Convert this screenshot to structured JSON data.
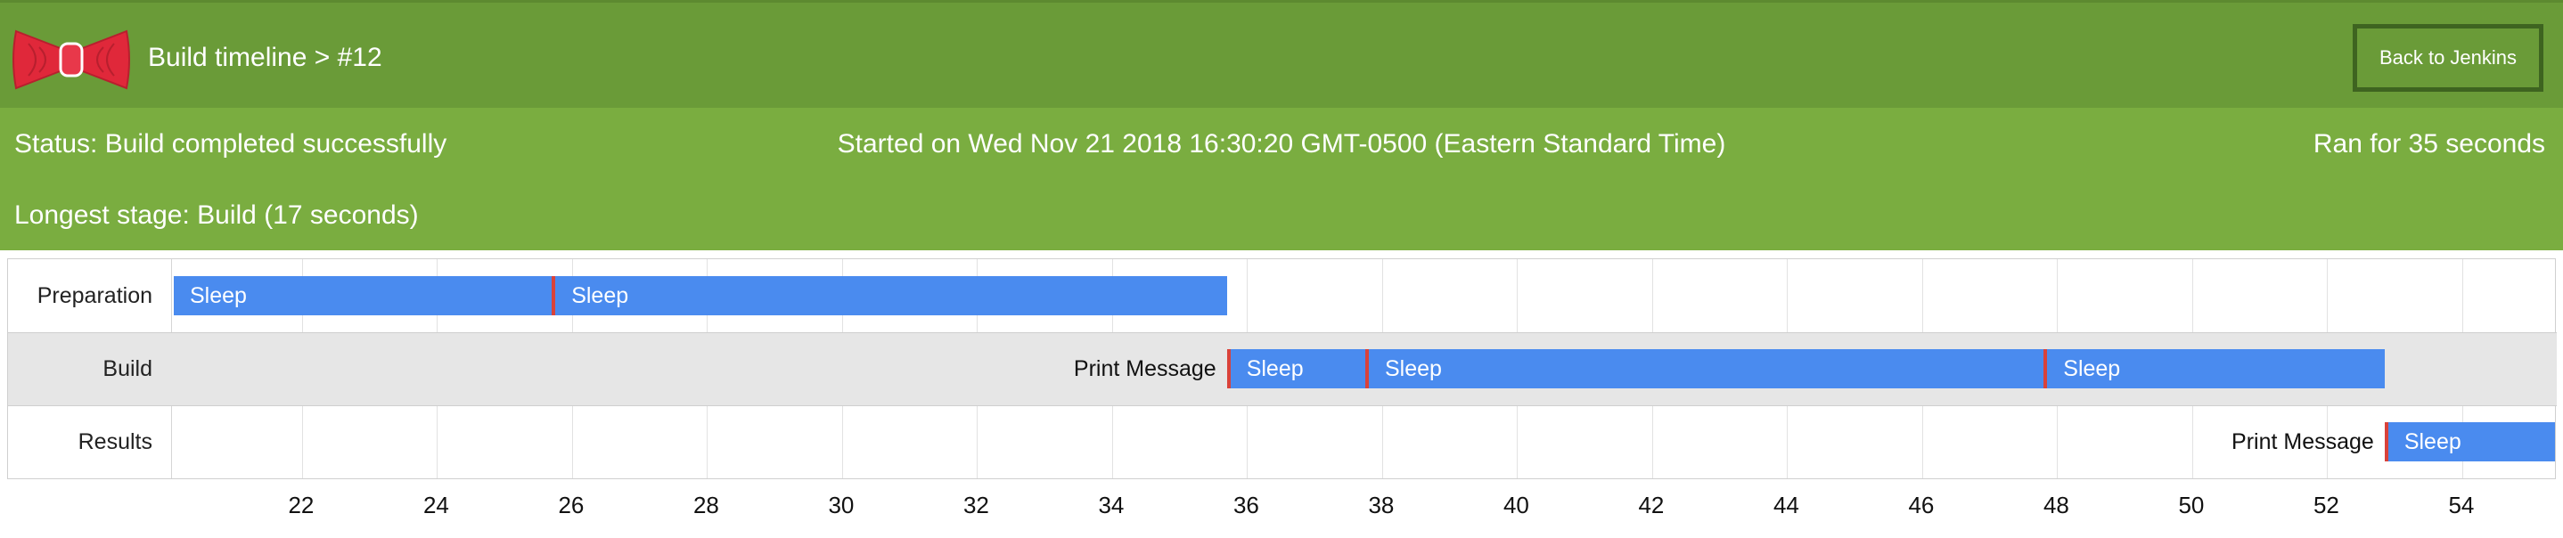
{
  "header": {
    "title": "Build timeline > #12",
    "back_button": "Back to Jenkins",
    "logo_icon": "red-bowtie-logo",
    "colors": {
      "header": "#6a9b38",
      "status": "#7aad40",
      "bar": "#4a8bef",
      "marker": "#d9423a"
    }
  },
  "status": {
    "status": "Status: Build completed successfully",
    "started": "Started on Wed Nov 21 2018 16:30:20 GMT-0500 (Eastern Standard Time)",
    "ran_for": "Ran for 35 seconds",
    "longest_stage": "Longest stage: Build (17 seconds)"
  },
  "timeline": {
    "axis_ticks": [
      "22",
      "24",
      "26",
      "28",
      "30",
      "32",
      "34",
      "36",
      "38",
      "40",
      "42",
      "44",
      "46",
      "48",
      "50",
      "52",
      "54"
    ],
    "lanes": [
      {
        "label": "Preparation",
        "tasks": [
          {
            "label": "Sleep",
            "start": 20.1,
            "end": 25.7,
            "marked": false
          },
          {
            "label": "Sleep",
            "start": 25.7,
            "end": 35.7,
            "marked": true
          }
        ]
      },
      {
        "label": "Build",
        "outside_label": "Print Message",
        "tasks": [
          {
            "label": "Sleep",
            "start": 35.7,
            "end": 37.75,
            "marked": true
          },
          {
            "label": "Sleep",
            "start": 37.75,
            "end": 47.8,
            "marked": true
          },
          {
            "label": "Sleep",
            "start": 47.8,
            "end": 52.85,
            "marked": true
          }
        ]
      },
      {
        "label": "Results",
        "outside_label": "Print Message",
        "tasks": [
          {
            "label": "Sleep",
            "start": 52.85,
            "end": 55.9,
            "marked": true
          }
        ]
      }
    ]
  }
}
